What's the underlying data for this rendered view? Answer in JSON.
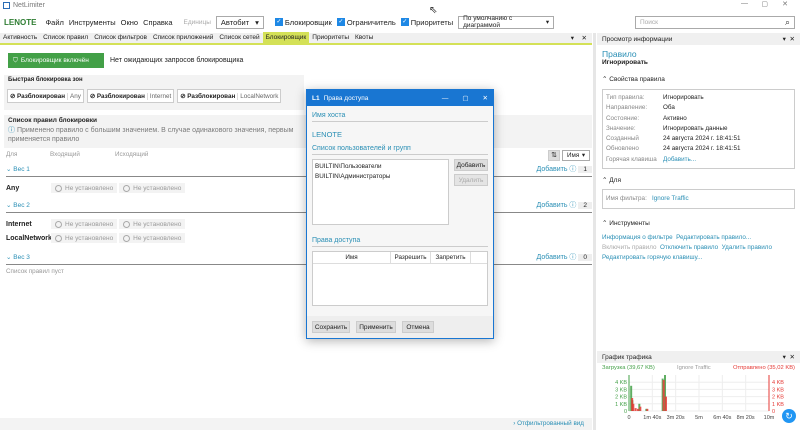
{
  "window": {
    "title": "NetLimiter"
  },
  "menu": {
    "brand": "LENOTE",
    "items": [
      "Файл",
      "Инструменты",
      "Окно",
      "Справка"
    ],
    "units_label": "Единицы",
    "units_value": "Автобит",
    "checks": [
      "Блокировщик",
      "Ограничитель",
      "Приоритеты"
    ],
    "view_value": "По умолчанию с диаграммой",
    "search_placeholder": "Поиск"
  },
  "tabs": [
    "Активность",
    "Список правил",
    "Список фильтров",
    "Список приложений",
    "Список сетей",
    "Блокировщик",
    "Приоритеты",
    "Квоты"
  ],
  "blocker": {
    "status_btn": "Блокировщик включён",
    "pending": "Нет ожидающих запросов блокировщика",
    "quick_title": "Быстрая блокировка зон",
    "zones": [
      {
        "state": "Разблокирован",
        "name": "Any"
      },
      {
        "state": "Разблокирован",
        "name": "Internet"
      },
      {
        "state": "Разблокирован",
        "name": "LocalNetwork"
      }
    ],
    "rules_title": "Список правил блокировки",
    "info": "Применено правило с большим значением. В случае одинакового значения, первым применяется правило",
    "cols": [
      "Для",
      "Входящий",
      "Исходящий"
    ],
    "sort_value": "Имя",
    "add_label": "Добавить",
    "not_set": "Не установлено",
    "groups": [
      {
        "label": "Вес 1",
        "count": "1",
        "rows": [
          "Any"
        ]
      },
      {
        "label": "Вес 2",
        "count": "2",
        "rows": [
          "Internet",
          "LocalNetwork"
        ]
      },
      {
        "label": "Вес 3",
        "count": "0",
        "rows": []
      }
    ],
    "empty": "Список правил пуст",
    "filtered_view": "Отфильтрованный вид"
  },
  "dialog": {
    "title": "Права доступа",
    "host_label": "Имя хоста",
    "host": "LENOTE",
    "users_label": "Список пользователей и групп",
    "users": [
      "BUILTIN\\Пользователи",
      "BUILTIN\\Администраторы"
    ],
    "add": "Добавить",
    "remove": "Удалить",
    "rights_label": "Права доступа",
    "cols": [
      "Имя",
      "Разрешить",
      "Запретить"
    ],
    "save": "Сохранить",
    "apply": "Применить",
    "cancel": "Отмена"
  },
  "info": {
    "header": "Просмотр информации",
    "kind": "Правило",
    "name": "Игнорировать",
    "props_title": "Свойства правила",
    "props": [
      {
        "k": "Тип правила:",
        "v": "Игнорировать"
      },
      {
        "k": "Направление:",
        "v": "Оба"
      },
      {
        "k": "Состояние:",
        "v": "Активно"
      },
      {
        "k": "Значение:",
        "v": "Игнорировать данные"
      },
      {
        "k": "Созданный",
        "v": "24 августа 2024 г. 18:41:51"
      },
      {
        "k": "Обновлено",
        "v": "24 августа 2024 г. 18:41:51"
      },
      {
        "k": "Горячая клавиша",
        "v": "Добавить..."
      }
    ],
    "for_title": "Для",
    "filter_k": "Имя фильтра:",
    "filter_v": "Ignore Traffic",
    "tools_title": "Инструменты",
    "tools": [
      "Информация о фильтре",
      "Редактировать правило...",
      "Включить правило",
      "Отключить правило",
      "Удалить правило",
      "Редактировать горячую клавишу..."
    ]
  },
  "traffic": {
    "header": "График трафика",
    "download": "Загрузка (39,67 KB)",
    "filter": "Ignore Traffic",
    "upload": "Отправлено (35,02 KB)"
  },
  "chart_data": {
    "type": "bar",
    "title": "График трафика",
    "x_ticks": [
      "0",
      "1m 40s",
      "3m 20s",
      "5m",
      "6m 40s",
      "8m 20s",
      "10m"
    ],
    "y_left_ticks": [
      "0",
      "1 KB",
      "2 KB",
      "3 KB",
      "4 KB"
    ],
    "y_right_ticks": [
      "0",
      "1 KB",
      "2 KB",
      "3 KB",
      "4 KB"
    ],
    "xlim_s": [
      0,
      600
    ],
    "ylim_kb": [
      0,
      5
    ],
    "series": [
      {
        "name": "Загрузка",
        "color": "#43a047",
        "x": [
          5,
          10,
          40,
          70,
          140,
          150
        ],
        "values": [
          3.5,
          1.5,
          1,
          0.3,
          4.5,
          5
        ]
      },
      {
        "name": "Отправлено",
        "color": "#e53935",
        "x": [
          5,
          10,
          20,
          30,
          40,
          70,
          140,
          150
        ],
        "values": [
          1.8,
          1,
          0.4,
          0.3,
          0.6,
          0.3,
          4.3,
          2
        ]
      }
    ]
  }
}
